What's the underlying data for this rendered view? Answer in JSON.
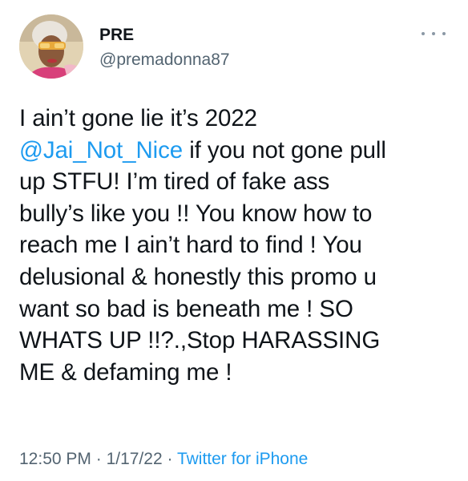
{
  "author": {
    "name": "PRE",
    "handle": "@premadonna87"
  },
  "tweet": {
    "line1": "I ain’t gone lie it’s 2022",
    "mention": "@Jai_Not_Nice",
    "line2_rest": " if you not gone pull",
    "line3": "up STFU! I’m tired of fake ass",
    "line4": "bully’s like you !! You know how to",
    "line5": "reach me I ain’t hard to find ! You",
    "line6": "delusional & honestly this promo u",
    "line7": "want so bad is beneath me ! SO",
    "line8": "WHATS UP !!?.,Stop HARASSING",
    "line9": "ME & defaming me !"
  },
  "meta": {
    "time": "12:50 PM",
    "sep1": " · ",
    "date": "1/17/22",
    "sep2": " · ",
    "source": "Twitter for iPhone"
  },
  "icons": {
    "more": "more-horizontal-icon"
  },
  "colors": {
    "link": "#1d9bf0",
    "secondary": "#536471",
    "primary": "#0f1419"
  }
}
